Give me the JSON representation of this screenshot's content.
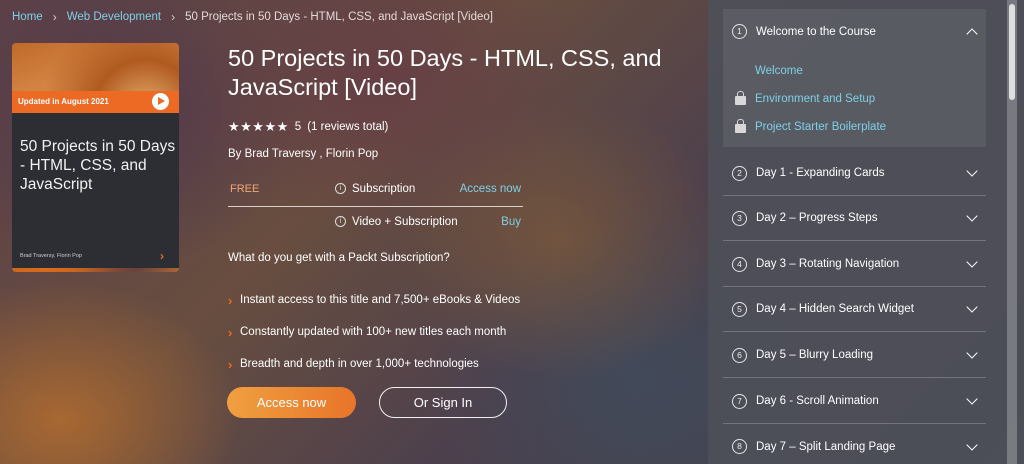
{
  "breadcrumb": {
    "home": "Home",
    "category": "Web Development",
    "current": "50 Projects in 50 Days - HTML, CSS, and JavaScript [Video]",
    "separator": "›"
  },
  "cover": {
    "badge": "Updated in August 2021",
    "title": "50 Projects in 50 Days - HTML, CSS, and JavaScript",
    "authors": "Brad Traversy, Florin Pop",
    "arrow": "›"
  },
  "product": {
    "title": "50 Projects in 50 Days - HTML, CSS, and JavaScript [Video]",
    "stars": "★★★★★",
    "rating": "5",
    "reviews": "(1 reviews total)",
    "authors": "By Brad Traversy , Florin Pop"
  },
  "pricing": {
    "free_label": "FREE",
    "info_glyph": "i",
    "options": [
      {
        "plan": "Subscription",
        "action": "Access now"
      },
      {
        "plan": "Video + Subscription",
        "action": "Buy"
      }
    ]
  },
  "subscription": {
    "question": "What do you get with a Packt Subscription?",
    "bullet": "›",
    "features": [
      "Instant access to this title and 7,500+ eBooks & Videos",
      "Constantly updated with 100+ new titles each month",
      "Breadth and depth in over 1,000+ technologies"
    ]
  },
  "buttons": {
    "access": "Access now",
    "signin": "Or Sign In"
  },
  "sidebar": {
    "sections": [
      {
        "number": "1",
        "title": "Welcome to the Course",
        "expanded": true,
        "lessons": [
          {
            "title": "Welcome",
            "locked": false
          },
          {
            "title": "Environment and Setup",
            "locked": true
          },
          {
            "title": "Project Starter Boilerplate",
            "locked": true
          }
        ]
      },
      {
        "number": "2",
        "title": "Day 1 - Expanding Cards"
      },
      {
        "number": "3",
        "title": "Day 2 – Progress Steps"
      },
      {
        "number": "4",
        "title": "Day 3 – Rotating Navigation"
      },
      {
        "number": "5",
        "title": "Day 4 – Hidden Search Widget"
      },
      {
        "number": "6",
        "title": "Day 5 – Blurry Loading"
      },
      {
        "number": "7",
        "title": "Day 6 - Scroll Animation"
      },
      {
        "number": "8",
        "title": "Day 7 – Split Landing Page"
      }
    ]
  },
  "colors": {
    "accent_orange": "#ec6a24",
    "link_blue": "#7fd0e6",
    "sidebar_bg": "#4e5058"
  }
}
